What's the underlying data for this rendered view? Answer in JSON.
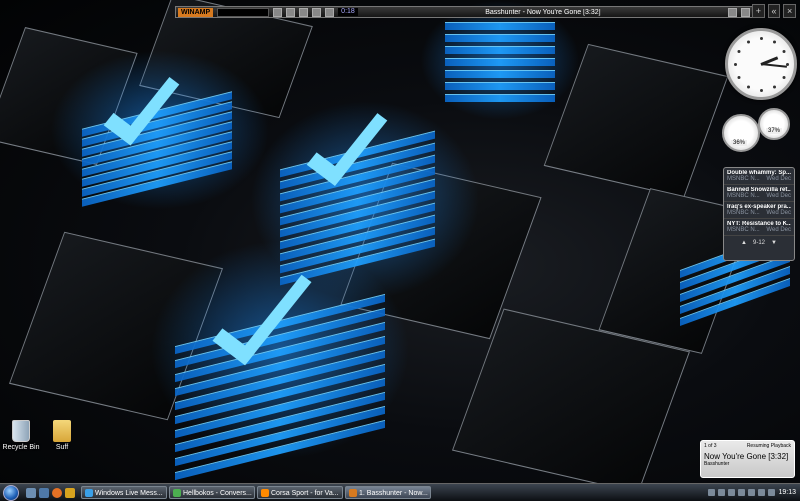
{
  "winamp": {
    "brand": "WINAMP",
    "time": "0:18",
    "track_title": "Basshunter - Now You're Gone [3:32]"
  },
  "sidebar_tools": {
    "add": "+",
    "nav": "«",
    "close": "×"
  },
  "clock": {
    "hour": 2,
    "minute": 16
  },
  "cpu_meter": {
    "cpu_label": "36%",
    "memory_label": "37%"
  },
  "news": {
    "items": [
      {
        "headline": "Double whammy: Sp...",
        "source": "MSNBC N...",
        "date": "Wed Dec"
      },
      {
        "headline": "Banned Snowzilla ret...",
        "source": "MSNBC N...",
        "date": "Wed Dec"
      },
      {
        "headline": "Iraq's ex-speaker pra...",
        "source": "MSNBC N...",
        "date": "Wed Dec"
      },
      {
        "headline": "NYT: Resistance to K...",
        "source": "MSNBC N...",
        "date": "Wed Dec"
      }
    ],
    "pager": "9-12",
    "prev": "▲",
    "next": "▼"
  },
  "desktop_icons": [
    {
      "label": "Recycle Bin",
      "icon": "recycle-bin-icon"
    },
    {
      "label": "Suff",
      "icon": "folder-icon"
    }
  ],
  "notification": {
    "counter": "1 of 3",
    "status": "Resuming Playback",
    "song": "Now You're Gone [3:32]",
    "artist": "Basshunter"
  },
  "taskbar": {
    "tasks": [
      {
        "label": "Windows Live Mess...",
        "color": "#3aa0e8",
        "active": false
      },
      {
        "label": "Hellbokos - Convers...",
        "color": "#4caf50",
        "active": false
      },
      {
        "label": "Corsa Sport - for Va...",
        "color": "#ff8a00",
        "active": false
      },
      {
        "label": "1. Basshunter - Now...",
        "color": "#d77a1f",
        "active": true
      }
    ],
    "clock": "19:13"
  }
}
